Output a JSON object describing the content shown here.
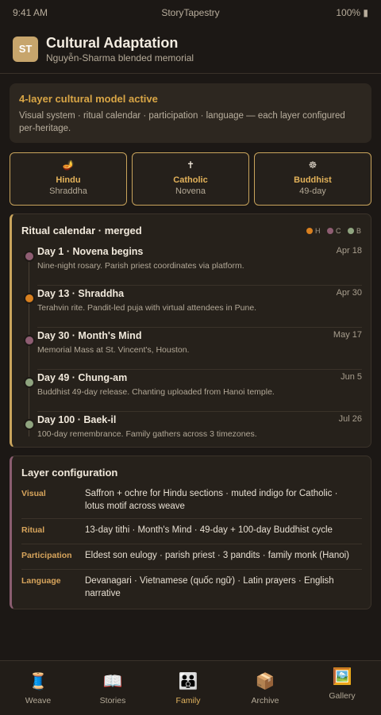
{
  "status_bar": {
    "time": "9:41 AM",
    "app": "StoryTapestry",
    "battery": "100% ▮"
  },
  "header": {
    "avatar": "ST",
    "title": "Cultural Adaptation",
    "subtitle": "Nguyễn-Sharma blended memorial"
  },
  "banner": {
    "title": "4-layer cultural model active",
    "text": "Visual system · ritual calendar · participation · language — each layer configured per-heritage."
  },
  "heritages": [
    {
      "icon": "🪔",
      "name": "Hindu",
      "sub": "Shraddha"
    },
    {
      "icon": "✝",
      "name": "Catholic",
      "sub": "Novena"
    },
    {
      "icon": "☸",
      "name": "Buddhist",
      "sub": "49-day"
    }
  ],
  "calendar": {
    "title": "Ritual calendar · merged",
    "legend": [
      {
        "label": "H",
        "color": "#d9801f"
      },
      {
        "label": "C",
        "color": "#8e5d72"
      },
      {
        "label": "B",
        "color": "#8fa47f"
      }
    ],
    "events": [
      {
        "title": "Day 1 · Novena begins",
        "date": "Apr 18",
        "desc": "Nine-night rosary. Parish priest coordinates via platform.",
        "color": "#8e5d72"
      },
      {
        "title": "Day 13 · Shraddha",
        "date": "Apr 30",
        "desc": "Terahvin rite. Pandit-led puja with virtual attendees in Pune.",
        "color": "#d9801f"
      },
      {
        "title": "Day 30 · Month's Mind",
        "date": "May 17",
        "desc": "Memorial Mass at St. Vincent's, Houston.",
        "color": "#8e5d72"
      },
      {
        "title": "Day 49 · Chung-am",
        "date": "Jun 5",
        "desc": "Buddhist 49-day release. Chanting uploaded from Hanoi temple.",
        "color": "#8fa47f"
      },
      {
        "title": "Day 100 · Baek-il",
        "date": "Jul 26",
        "desc": "100-day remembrance. Family gathers across 3 timezones.",
        "color": "#8fa47f"
      }
    ]
  },
  "layers": {
    "title": "Layer configuration",
    "rows": [
      {
        "key": "Visual",
        "value": "Saffron + ochre for Hindu sections · muted indigo for Catholic · lotus motif across weave"
      },
      {
        "key": "Ritual",
        "value": "13-day tithi · Month's Mind · 49-day + 100-day Buddhist cycle"
      },
      {
        "key": "Participation",
        "value": "Eldest son eulogy · parish priest · 3 pandits · family monk (Hanoi)"
      },
      {
        "key": "Language",
        "value": "Devanagari · Vietnamese (quốc ngữ) · Latin prayers · English narrative"
      }
    ]
  },
  "tabs": [
    {
      "icon": "🧵",
      "label": "Weave",
      "active": false
    },
    {
      "icon": "📖",
      "label": "Stories",
      "active": false
    },
    {
      "icon": "👪",
      "label": "Family",
      "active": true
    },
    {
      "icon": "📦",
      "label": "Archive",
      "active": false
    },
    {
      "icon": "🖼️",
      "label": "Gallery",
      "active": false
    }
  ]
}
